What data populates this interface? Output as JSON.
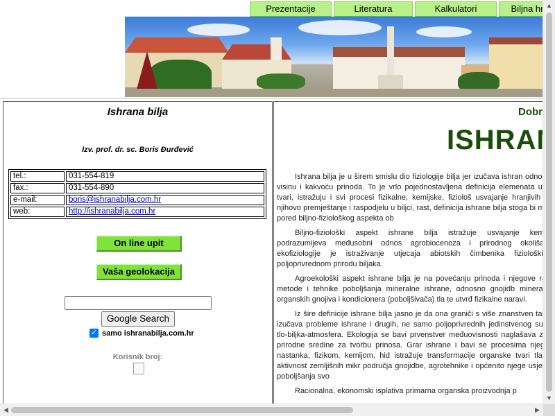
{
  "nav": {
    "tabs": [
      "Prezentacije",
      "Literatura",
      "Kalkulatori",
      "Biljna hr"
    ]
  },
  "sidebar": {
    "title": "Ishrana bilja",
    "author": "Izv. prof. dr. sc. Boris Đurđević",
    "contact": [
      {
        "label": "tel.:",
        "value": "031-554-819"
      },
      {
        "label": "fax.:",
        "value": "031-554-890"
      },
      {
        "label": "e-mail:",
        "value": "boris@ishranabilja.com.hr"
      },
      {
        "label": "web:",
        "value": "http://ishranabilja.com.hr"
      }
    ],
    "buttons": {
      "online": "On line upit",
      "geo": "Vaša geolokacija"
    },
    "search": {
      "value": "",
      "button": "Google Search",
      "checkbox_label": "samo ishranabilja.com.hr",
      "checked": true
    },
    "counter_label": "Korisnik broj:"
  },
  "main": {
    "greeting": "Dobr",
    "title": "ISHRAN",
    "paragraphs": [
      "Ishrana bilja je u širem smislu dio fiziologije bilja jer izučava ishran odnosu na visinu i kakvoću prinoda. To je vrlo pojednostavljena definicija elemenata u živoj tvari, istražuju i svi procesi fizikalne, kemijske, fiziološ usvajanje hranjivih tvari, njihovo premještanje i raspodjelu u biljci, rast, definicija ishrane bilja stoga bi morala pored biljno-fiziološkog aspekta ob",
      "Biljno-fiziološki aspekt ishrane bilja istražuje usvajanje kemijskih podrazumijeva međusobni odnos agrobiocenoza i prirodnog okoliša pa ekofiziologije je istraživanje utjecaja abiotskih čimbenika fizioloških p poljoprivrednom prirodu biljaka.",
      "Agroekološki aspekt ishrane bilja je na povećanju prinoda i njegove razvija metode i tehnike poboljšanja mineralne ishrane, odnosno gnojidb mineralnih i organskih gnojiva i kondicionera (poboljšivača) tla te utvrđ fizikalne naravi.",
      "Iz šire definicije ishrane bilja jasno je da ona graniči s više znanstven također izučava probleme ishrane i drugih, ne samo poljoprivrednih jedinstvenog sustava tlo-biljka-atmosfera. Ekologija se bavi prvenstver međuovisnosti naglašava značaj prirodne sredine za tvorbu prinosa. Grar ishrane i bavi se procesima njegovog nastanka, fizikom, kemijom, hid istražuje transformacije organske tvari tla kroz aktivnost zemljišnih mikr područja gnojidbe, agrotehnike i općenito njege usjeva uz poboljšanja svo",
      "Racionalna, ekonomski isplativa primarna organska proizvodnja p"
    ]
  },
  "colors": {
    "tab_green": "#b8f08a",
    "button_green": "#80e33a",
    "title_green": "#1a4d0a",
    "link_blue": "#0000cc"
  }
}
